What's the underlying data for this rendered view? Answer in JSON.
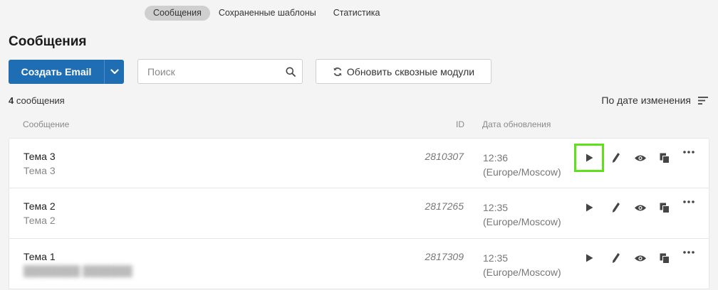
{
  "tabs": [
    {
      "label": "Сообщения",
      "active": true
    },
    {
      "label": "Сохраненные шаблоны",
      "active": false
    },
    {
      "label": "Статистика",
      "active": false
    }
  ],
  "page_title": "Сообщения",
  "toolbar": {
    "create_label": "Создать Email",
    "search_placeholder": "Поиск",
    "refresh_label": "Обновить сквозные модули"
  },
  "summary": {
    "count": "4",
    "count_label": "сообщения"
  },
  "sort": {
    "label": "По дате изменения"
  },
  "table_header": {
    "message": "Сообщение",
    "id": "ID",
    "updated": "Дата обновления"
  },
  "rows": [
    {
      "name": "Тема 3",
      "subject": "Тема 3",
      "id": "2810307",
      "time": "12:36",
      "tz": "(Europe/Moscow)"
    },
    {
      "name": "Тема 2",
      "subject": "Тема 2",
      "id": "2817265",
      "time": "12:35",
      "tz": "(Europe/Moscow)"
    },
    {
      "name": "Тема 1",
      "subject": "",
      "id": "2817309",
      "time": "12:35",
      "tz": "(Europe/Moscow)"
    }
  ],
  "colors": {
    "primary": "#1f6db2",
    "highlight": "#5ee01b",
    "background": "#f4f4f4"
  },
  "icons": {
    "row_actions": [
      "play-icon",
      "pencil-icon",
      "eye-icon",
      "copy-icon",
      "more-icon"
    ]
  }
}
